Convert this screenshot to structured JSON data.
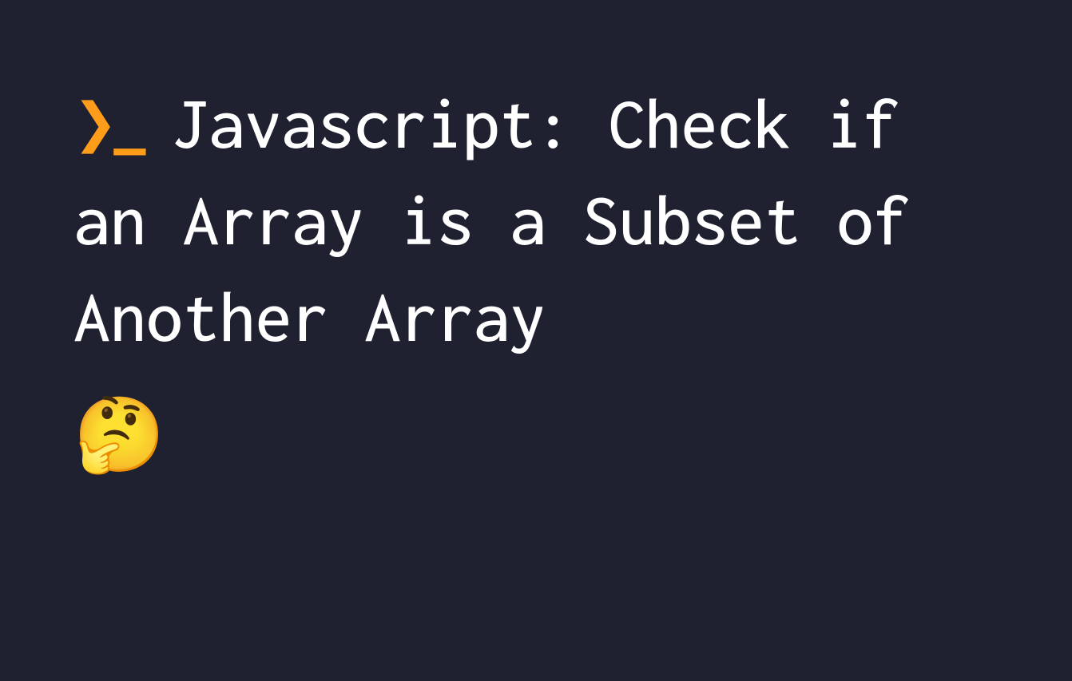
{
  "prompt_symbol": "❯_",
  "title": "Javascript: Check if an Array is a Subset of Another Array",
  "emoji": "🤔",
  "colors": {
    "background": "#1f2130",
    "text": "#ffffff",
    "accent": "#ff9c1a"
  }
}
